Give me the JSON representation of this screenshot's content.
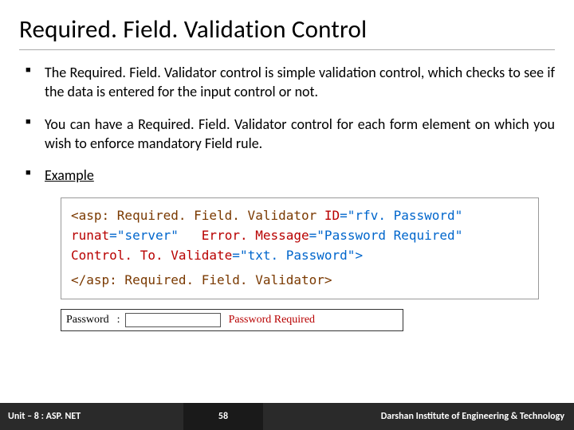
{
  "title": "Required. Field. Validation Control",
  "bullets": [
    "The Required. Field. Validator control is simple validation control, which checks to see if the data is entered for the input control or not.",
    "You can have a Required. Field. Validator control for each form element on which you wish to enforce mandatory Field rule.",
    "Example"
  ],
  "code": {
    "open_tag": "<asp: Required. Field. Validator",
    "attr_id_name": "ID",
    "attr_id_val": "\"rfv. Password\"",
    "attr_runat_name": "runat",
    "attr_runat_val": "\"server\"",
    "attr_err_name": "Error. Message",
    "attr_err_val": "\"Password Required\"",
    "attr_ctv_name": "Control. To. Validate",
    "attr_ctv_val": "\"txt. Password\"",
    "open_close": ">",
    "close_tag": "</asp: Required. Field. Validator>"
  },
  "demo": {
    "label": "Password",
    "colon": ":",
    "error": "Password Required"
  },
  "footer": {
    "unit": "Unit – 8 : ASP. NET",
    "page": "58",
    "inst": "Darshan Institute of Engineering & Technology"
  }
}
